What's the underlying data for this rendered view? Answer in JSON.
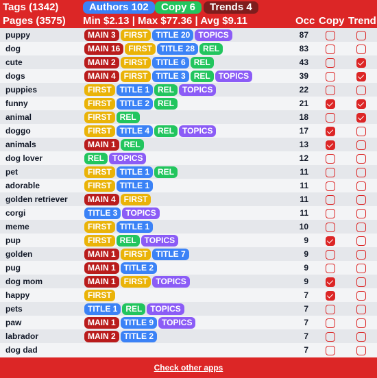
{
  "header": {
    "tags_label": "Tags (1342)",
    "pages_label": "Pages (3575)",
    "authors_pill": "Authors 102",
    "copy_pill": "Copy 6",
    "trends_pill": "Trends 4",
    "price_stats": "Min $2.13 | Max $77.36 | Avg $9.11",
    "columns": {
      "occ": "Occ",
      "copy": "Copy",
      "trend": "Trend"
    }
  },
  "colors": {
    "brand_red": "#dc2626",
    "main": "#b91c1c",
    "first": "#eab308",
    "title": "#3b82f6",
    "rel": "#22c55e",
    "topics": "#8b5cf6"
  },
  "rows": [
    {
      "tag": "puppy",
      "badges": [
        {
          "type": "main",
          "label": "MAIN 3"
        },
        {
          "type": "first",
          "label": "FIRST"
        },
        {
          "type": "title",
          "label": "TITLE 20"
        },
        {
          "type": "topics",
          "label": "TOPICS"
        }
      ],
      "occ": "87",
      "copy": false,
      "trend": false
    },
    {
      "tag": "dog",
      "badges": [
        {
          "type": "main",
          "label": "MAIN 16"
        },
        {
          "type": "first",
          "label": "FIRST"
        },
        {
          "type": "title",
          "label": "TITLE 28"
        },
        {
          "type": "rel",
          "label": "REL"
        }
      ],
      "occ": "83",
      "copy": false,
      "trend": false
    },
    {
      "tag": "cute",
      "badges": [
        {
          "type": "main",
          "label": "MAIN 2"
        },
        {
          "type": "first",
          "label": "FIRST"
        },
        {
          "type": "title",
          "label": "TITLE 6"
        },
        {
          "type": "rel",
          "label": "REL"
        }
      ],
      "occ": "43",
      "copy": false,
      "trend": true
    },
    {
      "tag": "dogs",
      "badges": [
        {
          "type": "main",
          "label": "MAIN 4"
        },
        {
          "type": "first",
          "label": "FIRST"
        },
        {
          "type": "title",
          "label": "TITLE 3"
        },
        {
          "type": "rel",
          "label": "REL"
        },
        {
          "type": "topics",
          "label": "TOPICS"
        }
      ],
      "occ": "39",
      "copy": false,
      "trend": true
    },
    {
      "tag": "puppies",
      "badges": [
        {
          "type": "first",
          "label": "FIRST"
        },
        {
          "type": "title",
          "label": "TITLE 1"
        },
        {
          "type": "rel",
          "label": "REL"
        },
        {
          "type": "topics",
          "label": "TOPICS"
        }
      ],
      "occ": "22",
      "copy": false,
      "trend": false
    },
    {
      "tag": "funny",
      "badges": [
        {
          "type": "first",
          "label": "FIRST"
        },
        {
          "type": "title",
          "label": "TITLE 2"
        },
        {
          "type": "rel",
          "label": "REL"
        }
      ],
      "occ": "21",
      "copy": true,
      "trend": true
    },
    {
      "tag": "animal",
      "badges": [
        {
          "type": "first",
          "label": "FIRST"
        },
        {
          "type": "rel",
          "label": "REL"
        }
      ],
      "occ": "18",
      "copy": false,
      "trend": true
    },
    {
      "tag": "doggo",
      "badges": [
        {
          "type": "first",
          "label": "FIRST"
        },
        {
          "type": "title",
          "label": "TITLE 4"
        },
        {
          "type": "rel",
          "label": "REL"
        },
        {
          "type": "topics",
          "label": "TOPICS"
        }
      ],
      "occ": "17",
      "copy": true,
      "trend": false
    },
    {
      "tag": "animals",
      "badges": [
        {
          "type": "main",
          "label": "MAIN 1"
        },
        {
          "type": "rel",
          "label": "REL"
        }
      ],
      "occ": "13",
      "copy": true,
      "trend": false
    },
    {
      "tag": "dog lover",
      "badges": [
        {
          "type": "rel",
          "label": "REL"
        },
        {
          "type": "topics",
          "label": "TOPICS"
        }
      ],
      "occ": "12",
      "copy": false,
      "trend": false
    },
    {
      "tag": "pet",
      "badges": [
        {
          "type": "first",
          "label": "FIRST"
        },
        {
          "type": "title",
          "label": "TITLE 1"
        },
        {
          "type": "rel",
          "label": "REL"
        }
      ],
      "occ": "11",
      "copy": false,
      "trend": false
    },
    {
      "tag": "adorable",
      "badges": [
        {
          "type": "first",
          "label": "FIRST"
        },
        {
          "type": "title",
          "label": "TITLE 1"
        }
      ],
      "occ": "11",
      "copy": false,
      "trend": false
    },
    {
      "tag": "golden retriever",
      "badges": [
        {
          "type": "main",
          "label": "MAIN 4"
        },
        {
          "type": "first",
          "label": "FIRST"
        }
      ],
      "occ": "11",
      "copy": false,
      "trend": false
    },
    {
      "tag": "corgi",
      "badges": [
        {
          "type": "title",
          "label": "TITLE 3"
        },
        {
          "type": "topics",
          "label": "TOPICS"
        }
      ],
      "occ": "11",
      "copy": false,
      "trend": false
    },
    {
      "tag": "meme",
      "badges": [
        {
          "type": "first",
          "label": "FIRST"
        },
        {
          "type": "title",
          "label": "TITLE 1"
        }
      ],
      "occ": "10",
      "copy": false,
      "trend": false
    },
    {
      "tag": "pup",
      "badges": [
        {
          "type": "first",
          "label": "FIRST"
        },
        {
          "type": "rel",
          "label": "REL"
        },
        {
          "type": "topics",
          "label": "TOPICS"
        }
      ],
      "occ": "9",
      "copy": true,
      "trend": false
    },
    {
      "tag": "golden",
      "badges": [
        {
          "type": "main",
          "label": "MAIN 1"
        },
        {
          "type": "first",
          "label": "FIRST"
        },
        {
          "type": "title",
          "label": "TITLE 7"
        }
      ],
      "occ": "9",
      "copy": false,
      "trend": false
    },
    {
      "tag": "pug",
      "badges": [
        {
          "type": "main",
          "label": "MAIN 1"
        },
        {
          "type": "title",
          "label": "TITLE 2"
        }
      ],
      "occ": "9",
      "copy": false,
      "trend": false
    },
    {
      "tag": "dog mom",
      "badges": [
        {
          "type": "main",
          "label": "MAIN 1"
        },
        {
          "type": "first",
          "label": "FIRST"
        },
        {
          "type": "topics",
          "label": "TOPICS"
        }
      ],
      "occ": "9",
      "copy": true,
      "trend": false
    },
    {
      "tag": "happy",
      "badges": [
        {
          "type": "first",
          "label": "FIRST"
        }
      ],
      "occ": "7",
      "copy": true,
      "trend": false
    },
    {
      "tag": "pets",
      "badges": [
        {
          "type": "title",
          "label": "TITLE 1"
        },
        {
          "type": "rel",
          "label": "REL"
        },
        {
          "type": "topics",
          "label": "TOPICS"
        }
      ],
      "occ": "7",
      "copy": false,
      "trend": false
    },
    {
      "tag": "paw",
      "badges": [
        {
          "type": "main",
          "label": "MAIN 1"
        },
        {
          "type": "title",
          "label": "TITLE 9"
        },
        {
          "type": "topics",
          "label": "TOPICS"
        }
      ],
      "occ": "7",
      "copy": false,
      "trend": false
    },
    {
      "tag": "labrador",
      "badges": [
        {
          "type": "main",
          "label": "MAIN 2"
        },
        {
          "type": "title",
          "label": "TITLE 2"
        }
      ],
      "occ": "7",
      "copy": false,
      "trend": false
    },
    {
      "tag": "dog dad",
      "badges": [],
      "occ": "7",
      "copy": false,
      "trend": false
    }
  ],
  "footer": {
    "link_label": "Check other apps"
  }
}
